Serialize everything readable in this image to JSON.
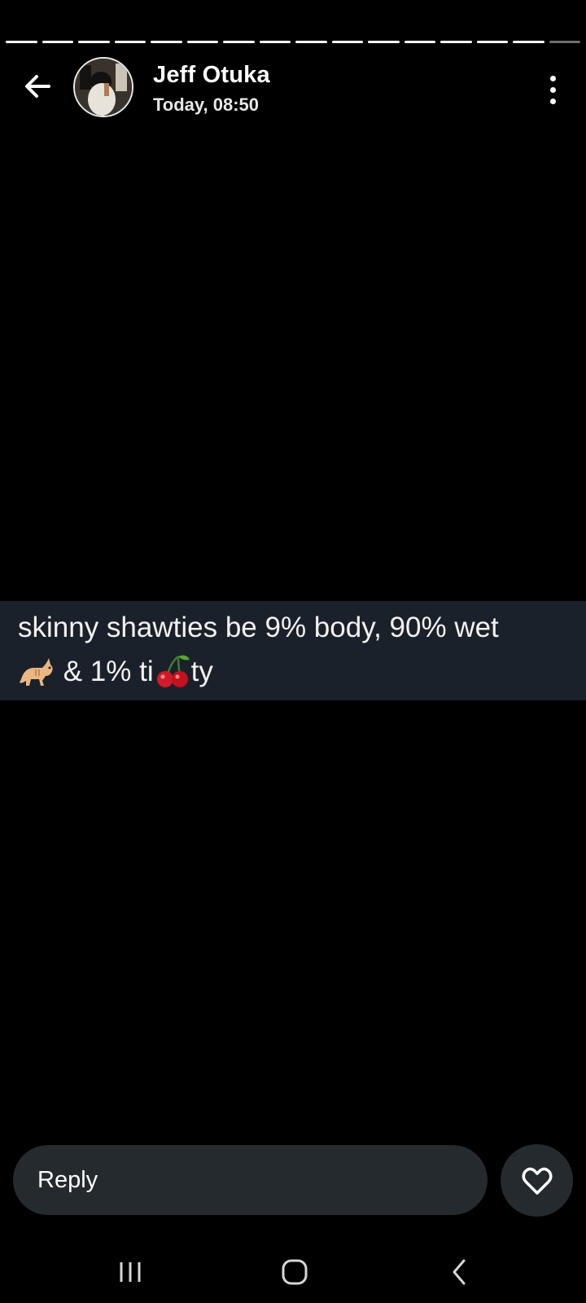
{
  "header": {
    "user_name": "Jeff Otuka",
    "timestamp": "Today, 08:50"
  },
  "progress": {
    "segments_total": 16,
    "segments_viewed": 15
  },
  "story": {
    "text_line1": "skinny shawties be 9% body, 90% wet",
    "text_line2_a": "& 1% ti",
    "text_line2_b": "ty",
    "emoji_1": "cat-emoji",
    "emoji_2": "cherries-emoji",
    "background": "#1b212b"
  },
  "reply": {
    "placeholder": "Reply"
  },
  "icons": {
    "back": "back-arrow-icon",
    "more": "more-vertical-icon",
    "like": "heart-outline-icon",
    "recents": "recents-icon",
    "home": "home-icon",
    "nav_back": "nav-back-icon"
  },
  "colors": {
    "background": "#000000",
    "reply_field": "#252a2e",
    "text": "#ffffff"
  }
}
